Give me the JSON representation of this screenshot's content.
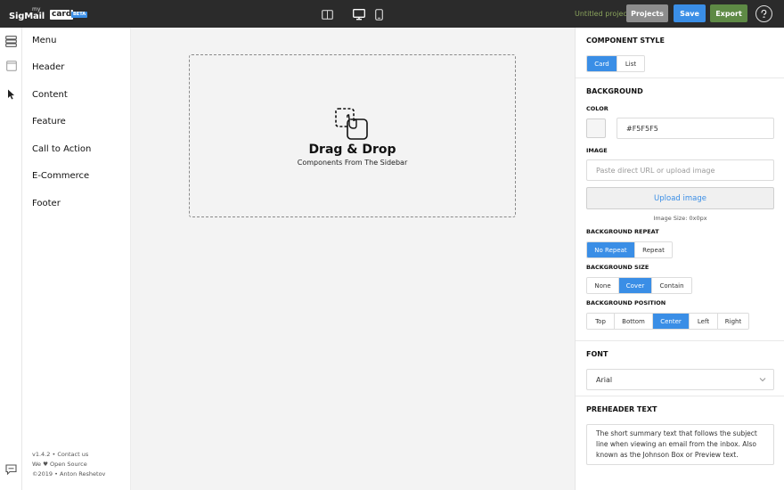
{
  "app": {
    "logo_my": "my",
    "logo_sig": "SigMail",
    "logo_card": "card",
    "logo_beta": "BETA"
  },
  "topbar": {
    "project_name": "Untitled project",
    "projects_label": "Projects",
    "save_label": "Save",
    "export_label": "Export"
  },
  "categories": [
    "Menu",
    "Header",
    "Content",
    "Feature",
    "Call to Action",
    "E-Commerce",
    "Footer"
  ],
  "sidebar_footer": {
    "line1": "v1.4.2 • Contact us",
    "line2": "We ♥ Open Source",
    "line3": "©2019 • Anton Reshetov"
  },
  "canvas": {
    "title": "Drag & Drop",
    "subtitle": "Components From The Sidebar"
  },
  "panel": {
    "component_style": {
      "title": "COMPONENT STYLE",
      "options": [
        "Card",
        "List"
      ],
      "selected": "Card"
    },
    "background": {
      "title": "BACKGROUND",
      "color_label": "COLOR",
      "color_value": "#F5F5F5",
      "image_label": "IMAGE",
      "image_placeholder": "Paste direct URL or upload image",
      "upload_label": "Upload image",
      "image_size": "Image Size: 0x0px",
      "repeat_label": "BACKGROUND REPEAT",
      "repeat_options": [
        "No Repeat",
        "Repeat"
      ],
      "repeat_selected": "No Repeat",
      "size_label": "BACKGROUND SIZE",
      "size_options": [
        "None",
        "Cover",
        "Contain"
      ],
      "size_selected": "Cover",
      "position_label": "BACKGROUND POSITION",
      "position_options": [
        "Top",
        "Bottom",
        "Center",
        "Left",
        "Right"
      ],
      "position_selected": "Center"
    },
    "font": {
      "title": "FONT",
      "value": "Arial"
    },
    "preheader": {
      "title": "PREHEADER TEXT",
      "value": "The short summary text that follows the subject line when viewing an email from the inbox. Also known as the Johnson Box or Preview text."
    }
  },
  "colors": {
    "topbar": "#2b2b2b",
    "accent": "#3a8ee6",
    "export": "#5e8a45",
    "projects": "#8d8d8d",
    "project_name": "#8aa35c"
  },
  "icons": {
    "rail": [
      "layers-icon",
      "page-icon",
      "cursor-icon",
      "chat-icon"
    ],
    "devices": [
      "tablet-landscape-icon",
      "desktop-icon",
      "mobile-icon"
    ]
  }
}
